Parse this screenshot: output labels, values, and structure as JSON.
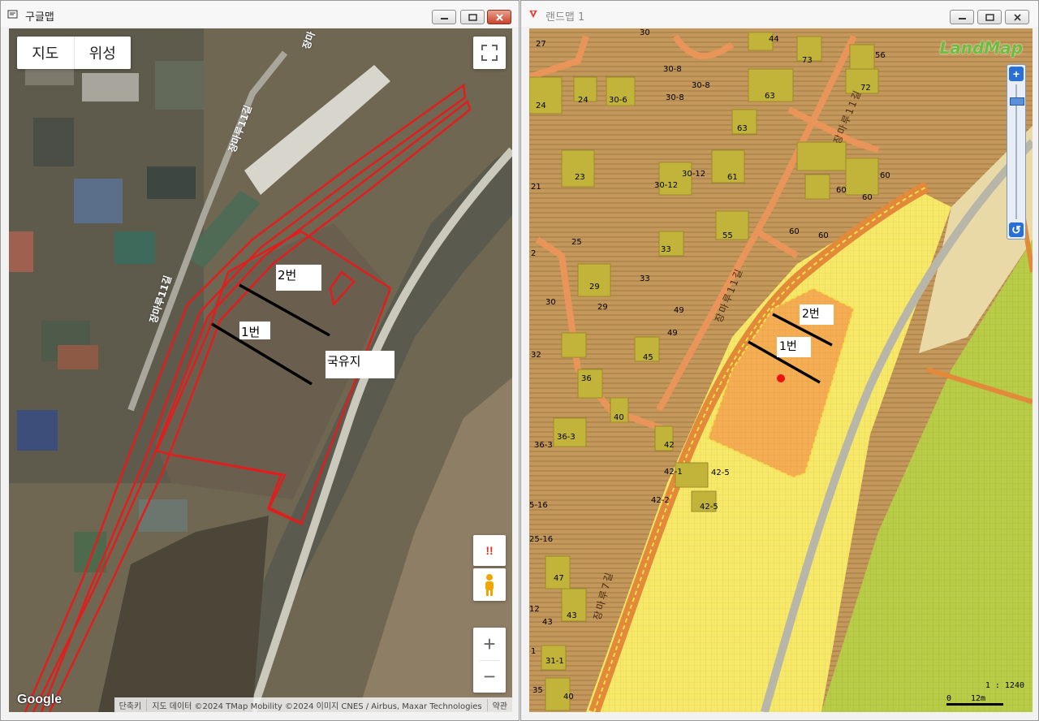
{
  "left_window": {
    "title": "구글맵",
    "map_type": {
      "map": "지도",
      "satellite": "위성"
    },
    "road_label_a": "장마루11길",
    "road_label_b": "장마루11길",
    "road_label_c": "장마",
    "parcel_labels": {
      "no2": "2번",
      "no1": "1번",
      "state": "국유지"
    },
    "attribution": {
      "shortcuts": "단축키",
      "data": "지도 데이터 ©2024 TMap Mobility ©2024 이미지 CNES / Airbus, Maxar Technologies",
      "terms": "약관"
    },
    "google_logo": "Google",
    "warning_glyph": "!!",
    "zoom_in": "+",
    "zoom_out": "−"
  },
  "right_window": {
    "title": "랜드맵 1",
    "logo": "LandMap",
    "parcel_labels": {
      "no2": "2번",
      "no1": "1번"
    },
    "road_label_a": "장마루11길",
    "road_label_b": "장마루11길",
    "road_label_c": "장마루7길",
    "scale_ratio": "1 : 1240",
    "scale_zero": "0",
    "scale_len": "12m",
    "lot_numbers": [
      "30",
      "44",
      "27",
      "73",
      "56",
      "30-8",
      "30-8",
      "72",
      "24",
      "24",
      "30-6",
      "30-8",
      "63",
      "63",
      "23",
      "30-12",
      "30-12",
      "61",
      "60",
      "60",
      "60",
      "21",
      "25",
      "55",
      "33",
      "60",
      "60",
      "2",
      "29",
      "33",
      "29",
      "30",
      "49",
      "49",
      "32",
      "45",
      "36",
      "40",
      "36-3",
      "36-3",
      "42",
      "42-1",
      "42-5",
      "42-2",
      "42-5",
      "25-16",
      "5-16",
      "47",
      "43",
      "12",
      "43",
      "31-1",
      "1",
      "35",
      "40"
    ]
  }
}
